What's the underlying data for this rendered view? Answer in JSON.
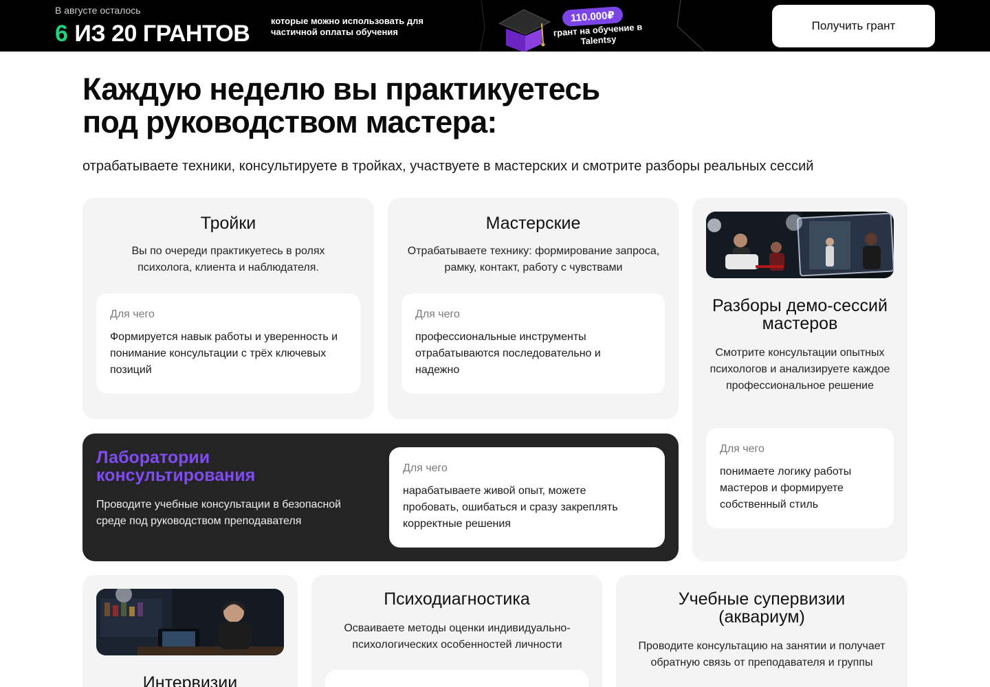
{
  "banner": {
    "remain_label": "В августе осталось",
    "count_num": "6",
    "count_rest": "ИЗ 20 ГРАНТОВ",
    "description": "которые можно использовать для частичной оплаты обучения",
    "price": "110.000₽",
    "grant_text": "грант на обучение в Talentsy",
    "cta_label": "Получить грант"
  },
  "hero": {
    "title_line1": "Каждую неделю вы практикуетесь",
    "title_line2": "под руководством мастера:",
    "subtitle": "отрабатываете техники, консультируете в тройках, участвуете в мастерских и смотрите разборы реальных сессий"
  },
  "cards": {
    "troiki": {
      "title": "Тройки",
      "text": "Вы по очереди практикуетесь в ролях психолога, клиента и наблюдателя.",
      "why_label": "Для чего",
      "why_text": "Формируется навык работы и уверенность и понимание консультации с трёх ключевых позиций"
    },
    "masterskie": {
      "title": "Мастерские",
      "text": "Отрабатываете технику: формирование запроса, рамку, контакт, работу с чувствами",
      "why_label": "Для чего",
      "why_text": "профессиональные инструменты отрабатываются последовательно и надежно"
    },
    "razbory": {
      "title": "Разборы демо-сессий мастеров",
      "text": "Смотрите консультации опытных психологов и анализируете каждое профессиональное решение",
      "why_label": "Для чего",
      "why_text": "понимаете логику работы мастеров и формируете собственный стиль"
    },
    "lab": {
      "title": "Лаборатории консультирования",
      "text": "Проводите учебные консультации в безопасной среде под руководством преподавателя",
      "why_label": "Для чего",
      "why_text": "нарабатываете живой опыт, можете пробовать, ошибаться и сразу закреплять корректные решения"
    },
    "intervizii": {
      "title": "Интервизии"
    },
    "psychodiag": {
      "title": "Психодиагностика",
      "text": "Осваиваете методы оценки индивидуально-психологических особенностей личности"
    },
    "supervizii": {
      "title": "Учебные супервизии (аквариум)",
      "text": "Проводите консультацию на занятии и получает обратную связь от преподавателя и группы"
    }
  },
  "colors": {
    "accent_green": "#1fd17b",
    "accent_purple": "#7b45e8",
    "card_bg": "#f4f4f4",
    "dark_card_bg": "#242424"
  }
}
